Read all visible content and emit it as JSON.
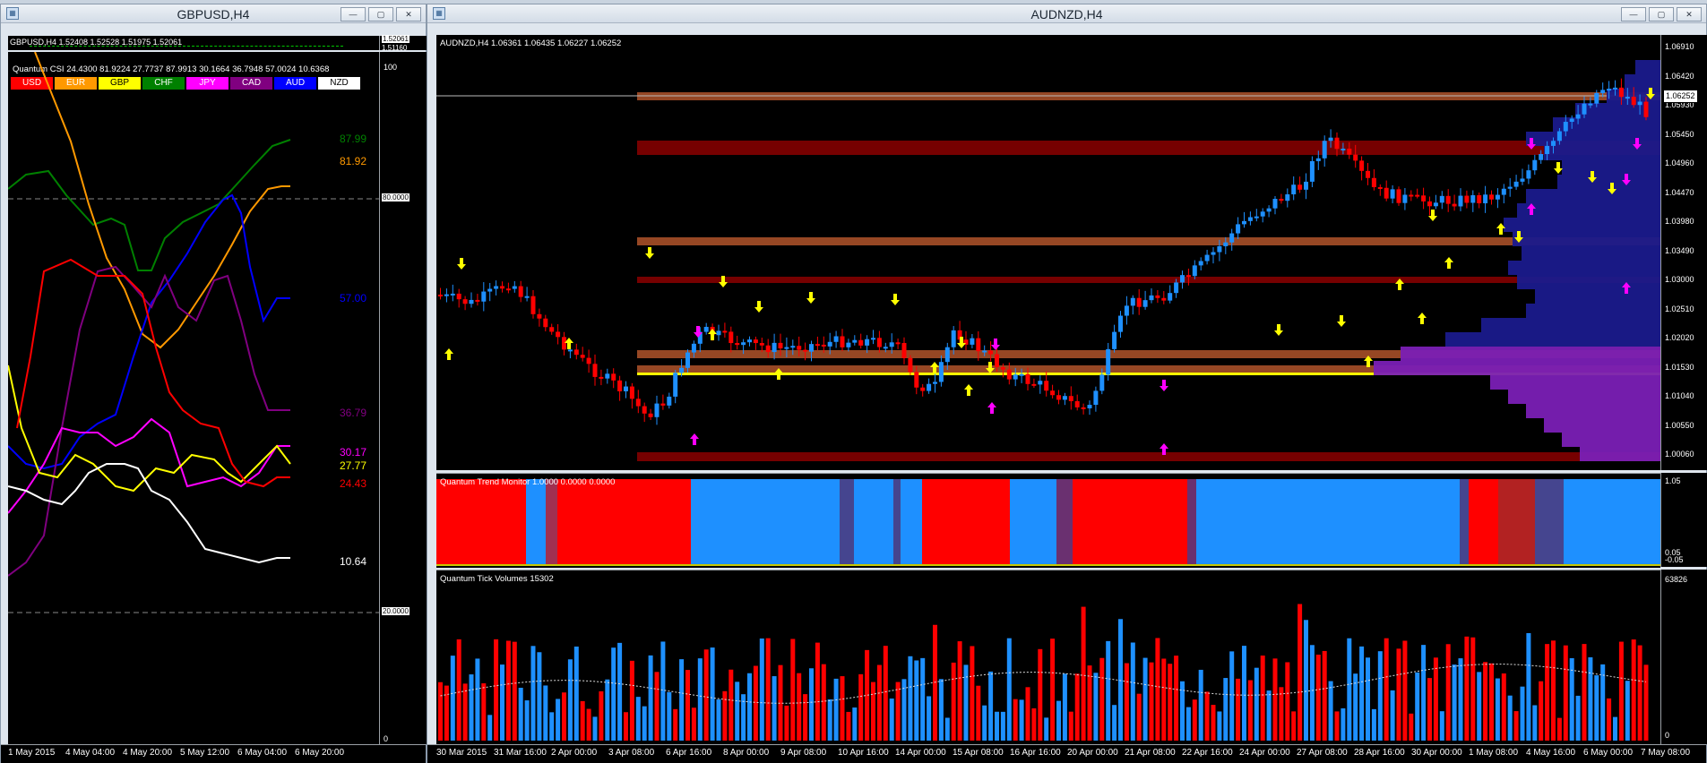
{
  "left_window": {
    "title": "GBPUSD,H4",
    "buttons": [
      "—",
      "▢",
      "✕"
    ],
    "symbol_row": "GBPUSD,H4  1.52408 1.52528 1.51975 1.52061",
    "mini_prices": [
      "1.52061",
      "1.51160"
    ],
    "indicator_label": "Quantum CSI 24.4300 81.9224 27.7737 87.9913 30.1664 36.7948 57.0024 10.6368",
    "currencies": [
      {
        "code": "USD",
        "bg": "#ff0000",
        "fg": "#ffffff"
      },
      {
        "code": "EUR",
        "bg": "#ff9900",
        "fg": "#ffffff"
      },
      {
        "code": "GBP",
        "bg": "#ffff00",
        "fg": "#000000"
      },
      {
        "code": "CHF",
        "bg": "#008000",
        "fg": "#ffffff"
      },
      {
        "code": "JPY",
        "bg": "#ff00ff",
        "fg": "#ffffff"
      },
      {
        "code": "CAD",
        "bg": "#800080",
        "fg": "#ffffff"
      },
      {
        "code": "AUD",
        "bg": "#0000ff",
        "fg": "#ffffff"
      },
      {
        "code": "NZD",
        "bg": "#ffffff",
        "fg": "#000000"
      }
    ],
    "axis_labels": [
      "100",
      "80.0000",
      "20.0000",
      "0"
    ],
    "value_labels": [
      {
        "text": "87.99",
        "color": "#008000"
      },
      {
        "text": "81.92",
        "color": "#ff9900"
      },
      {
        "text": "57.00",
        "color": "#0000ff"
      },
      {
        "text": "36.79",
        "color": "#800080"
      },
      {
        "text": "30.17",
        "color": "#ff00ff"
      },
      {
        "text": "27.77",
        "color": "#ffff00"
      },
      {
        "text": "24.43",
        "color": "#ff0000"
      },
      {
        "text": "10.64",
        "color": "#ffffff"
      }
    ],
    "time_labels": [
      "1 May 2015",
      "4 May 04:00",
      "4 May 20:00",
      "5 May 12:00",
      "6 May 04:00",
      "6 May 20:00"
    ]
  },
  "right_window": {
    "title": "AUDNZD,H4",
    "buttons": [
      "—",
      "▢",
      "✕"
    ],
    "symbol_row": "AUDNZD,H4  1.06361 1.06435 1.06227 1.06252",
    "price_labels": [
      "1.06910",
      "1.06420",
      "1.05930",
      "1.05450",
      "1.04960",
      "1.04470",
      "1.03980",
      "1.03490",
      "1.03000",
      "1.02510",
      "1.02020",
      "1.01530",
      "1.01040",
      "1.00550",
      "1.00060"
    ],
    "current_price": "1.06252",
    "trend_monitor_label": "Quantum Trend Monitor 1.0000 0.0000 0.0000",
    "trend_axis": [
      "1.05",
      "0.05",
      "-0.05"
    ],
    "tick_volumes_label": "Quantum Tick Volumes 15302",
    "volume_axis": [
      "63826",
      "0"
    ],
    "time_labels": [
      "30 Mar 2015",
      "31 Mar 16:00",
      "2 Apr 00:00",
      "3 Apr 08:00",
      "6 Apr 16:00",
      "8 Apr 00:00",
      "9 Apr 08:00",
      "10 Apr 16:00",
      "14 Apr 00:00",
      "15 Apr 08:00",
      "16 Apr 16:00",
      "20 Apr 00:00",
      "21 Apr 08:00",
      "22 Apr 16:00",
      "24 Apr 00:00",
      "27 Apr 08:00",
      "28 Apr 16:00",
      "30 Apr 00:00",
      "1 May 08:00",
      "4 May 16:00",
      "6 May 00:00",
      "7 May 08:00"
    ]
  },
  "colors": {
    "bull": "#1e90ff",
    "bear": "#ff0000",
    "arrow_yellow": "#ffff00",
    "arrow_magenta": "#ff00ff"
  }
}
